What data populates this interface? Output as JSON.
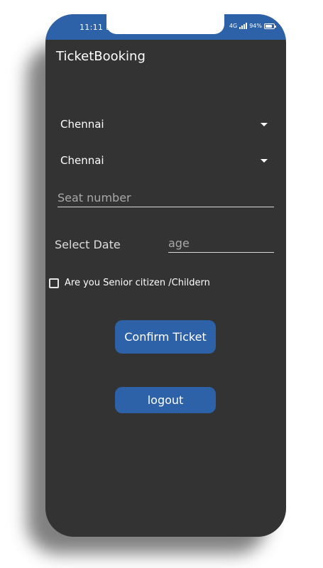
{
  "status_bar": {
    "time": "11:11",
    "network": "4G",
    "battery": "94%",
    "icons": [
      "notification-icon",
      "signal-icon",
      "battery-icon"
    ]
  },
  "app": {
    "title": "TicketBooking"
  },
  "form": {
    "from_city": "Chennai",
    "to_city": "Chennai",
    "seat_placeholder": "Seat number",
    "date_label": "Select Date",
    "age_placeholder": "age",
    "senior_checkbox_label": "Are you Senior citizen /Childern",
    "senior_checked": false
  },
  "buttons": {
    "confirm": "Confirm Ticket",
    "logout": "logout"
  },
  "colors": {
    "accent": "#2d62a8",
    "background": "#333333",
    "text": "#ffffff"
  }
}
